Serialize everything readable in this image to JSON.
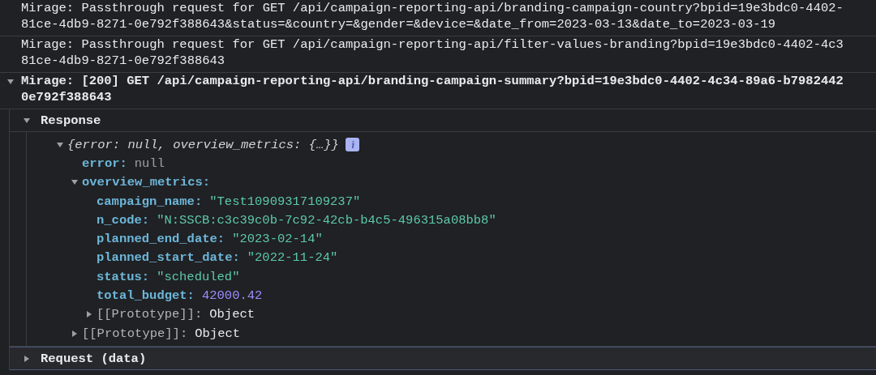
{
  "log_messages": [
    {
      "kind": "plain",
      "lines": [
        "Mirage: Passthrough request for GET /api/campaign-reporting-api/branding-campaign-country?bpid=19e3bdc0-4402-",
        "81ce-4db9-8271-0e792f388643&status=&country=&gender=&device=&date_from=2023-03-13&date_to=2023-03-19"
      ]
    },
    {
      "kind": "plain",
      "lines": [
        "Mirage: Passthrough request for GET /api/campaign-reporting-api/filter-values-branding?bpid=19e3bdc0-4402-4c3",
        "81ce-4db9-8271-0e792f388643"
      ]
    },
    {
      "kind": "expandable",
      "expanded": true,
      "lines": [
        "Mirage: [200] GET /api/campaign-reporting-api/branding-campaign-summary?bpid=19e3bdc0-4402-4c34-89a6-b7982442",
        "0e792f388643"
      ]
    }
  ],
  "sections": [
    {
      "title": "Response",
      "expanded": true,
      "tree": {
        "preview": "{error: null, overview_metrics: {…}}",
        "expanded": true,
        "children": [
          {
            "key": "error:",
            "kind": "null",
            "value": "null"
          },
          {
            "key": "overview_metrics:",
            "kind": "object",
            "expanded": true,
            "children": [
              {
                "key": "campaign_name:",
                "kind": "string",
                "value": "\"Test10909317109237\""
              },
              {
                "key": "n_code:",
                "kind": "string",
                "value": "\"N:SSCB:c3c39c0b-7c92-42cb-b4c5-496315a08bb8\""
              },
              {
                "key": "planned_end_date:",
                "kind": "string",
                "value": "\"2023-02-14\""
              },
              {
                "key": "planned_start_date:",
                "kind": "string",
                "value": "\"2022-11-24\""
              },
              {
                "key": "status:",
                "kind": "string",
                "value": "\"scheduled\""
              },
              {
                "key": "total_budget:",
                "kind": "number",
                "value": "42000.42"
              },
              {
                "key": "[[Prototype]]:",
                "kind": "prototype",
                "expanded": false,
                "value": "Object"
              }
            ]
          },
          {
            "key": "[[Prototype]]:",
            "kind": "prototype",
            "expanded": false,
            "value": "Object"
          }
        ]
      }
    },
    {
      "title": "Request (data)",
      "expanded": false
    }
  ]
}
